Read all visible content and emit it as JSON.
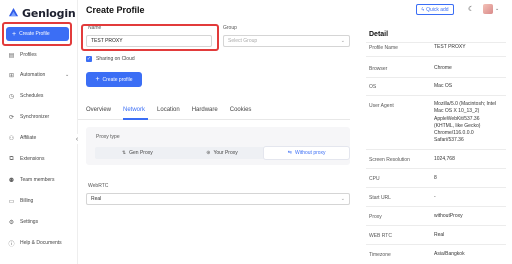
{
  "app": {
    "name": "Genlogin"
  },
  "sidebar": {
    "create_button": "Create Profile",
    "items": [
      {
        "label": "Profiles",
        "icon": "profiles-icon"
      },
      {
        "label": "Automation",
        "icon": "automation-icon",
        "expandable": true
      },
      {
        "label": "Schedules",
        "icon": "schedules-icon"
      },
      {
        "label": "Synchronizer",
        "icon": "synchronizer-icon"
      },
      {
        "label": "Affiliate",
        "icon": "affiliate-icon"
      },
      {
        "label": "Extensions",
        "icon": "extensions-icon"
      },
      {
        "label": "Team members",
        "icon": "team-icon"
      },
      {
        "label": "Billing",
        "icon": "billing-icon"
      },
      {
        "label": "Settings",
        "icon": "settings-icon"
      },
      {
        "label": "Help & Documents",
        "icon": "help-icon"
      }
    ]
  },
  "main": {
    "title": "Create Profile",
    "name_label": "Name",
    "name_value": "TEST PROXY",
    "group_label": "Group",
    "group_placeholder": "Select Group",
    "sharing_label": "Sharing on Cloud",
    "sharing_checked": true,
    "create_profile_button": "Create profile",
    "tabs": [
      "Overview",
      "Network",
      "Location",
      "Hardware",
      "Cookies"
    ],
    "active_tab": "Network",
    "proxy_type_label": "Proxy type",
    "proxy_options": [
      "Gen Proxy",
      "Your Proxy",
      "Without proxy"
    ],
    "proxy_selected": "Without proxy",
    "webrtc_label": "WebRTC",
    "webrtc_value": "Real"
  },
  "header": {
    "quick_add": "Quick add"
  },
  "detail": {
    "title": "Detail",
    "rows": [
      {
        "key": "Profile Name",
        "value": "TEST PROXY"
      },
      {
        "key": "Browser",
        "value": "Chrome"
      },
      {
        "key": "OS",
        "value": "Mac OS"
      },
      {
        "key": "User Agent",
        "value": "Mozilla/5.0 (Macintosh; Intel Mac OS X 10_13_2) AppleWebKit/537.36 (KHTML, like Gecko) Chrome/116.0.0.0 Safari/537.36"
      },
      {
        "key": "Screen Resolution",
        "value": "1024,768"
      },
      {
        "key": "CPU",
        "value": "8"
      },
      {
        "key": "Start URL",
        "value": "-"
      },
      {
        "key": "Proxy",
        "value": "withoutProxy"
      },
      {
        "key": "WEB RTC",
        "value": "Real"
      },
      {
        "key": "Timezone",
        "value": "Asia/Bangkok"
      }
    ]
  },
  "colors": {
    "accent": "#3b6ef5",
    "highlight": "#e23b3b"
  }
}
